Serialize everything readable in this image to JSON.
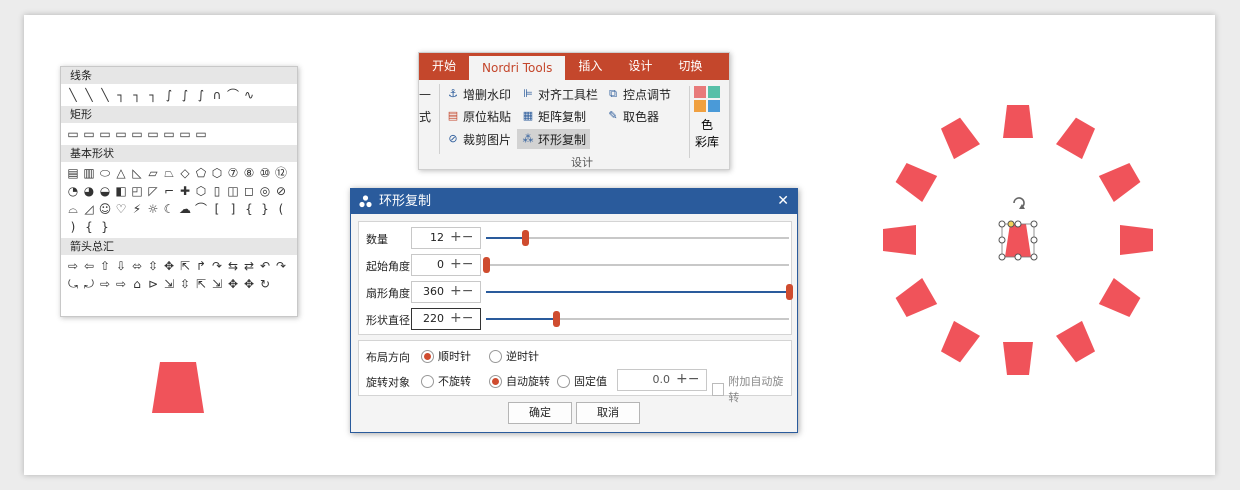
{
  "gallery": {
    "sections": [
      {
        "title": "线条",
        "icons": [
          "╲",
          "╲",
          "╲",
          "┐",
          "┐",
          "┐",
          "∫",
          "∫",
          "∫",
          "∩",
          "⌒",
          "∿"
        ]
      },
      {
        "title": "矩形",
        "icons": [
          "▭",
          "▭",
          "▭",
          "▭",
          "▭",
          "▭",
          "▭",
          "▭",
          "▭"
        ]
      },
      {
        "title": "基本形状",
        "icons": [
          "▤",
          "▥",
          "⬭",
          "△",
          "◺",
          "▱",
          "⏢",
          "◇",
          "⬠",
          "⬡",
          "⑦",
          "⑧",
          "⑩",
          "⑫",
          "◔",
          "◕",
          "◒",
          "◧",
          "◰",
          "◸",
          "⌐",
          "✚",
          "⬡",
          "▯",
          "◫",
          "◻",
          "◎",
          "⊘",
          "⌓",
          "◿",
          "☺",
          "♡",
          "⚡",
          "☼",
          "☾",
          "☁",
          "⌒",
          "[",
          "]",
          "{",
          "}",
          "(",
          ")",
          "{",
          "}"
        ]
      },
      {
        "title": "箭头总汇",
        "icons": [
          "⇨",
          "⇦",
          "⇧",
          "⇩",
          "⬄",
          "⇳",
          "✥",
          "⇱",
          "↱",
          "↷",
          "⇆",
          "⇄",
          "↶",
          "↷",
          "⤿",
          "⤾",
          "⇨",
          "⇨",
          "⌂",
          "⊳",
          "⇲",
          "⇳",
          "⇱",
          "⇲",
          "✥",
          "✥",
          "↻"
        ]
      }
    ]
  },
  "ribbon": {
    "tabs": [
      {
        "label": "开始",
        "active": false
      },
      {
        "label": "Nordri Tools",
        "active": true
      },
      {
        "label": "插入",
        "active": false
      },
      {
        "label": "设计",
        "active": false
      },
      {
        "label": "切换",
        "active": false
      }
    ],
    "partial_label": "式",
    "items": [
      {
        "label": "增删水印",
        "icon": "stamp-icon"
      },
      {
        "label": "对齐工具栏",
        "icon": "align-icon"
      },
      {
        "label": "控点调节",
        "icon": "handle-icon"
      },
      {
        "label": "原位粘贴",
        "icon": "paste-icon"
      },
      {
        "label": "矩阵复制",
        "icon": "matrix-icon"
      },
      {
        "label": "取色器",
        "icon": "eyedropper-icon"
      },
      {
        "label": "裁剪图片",
        "icon": "crop-icon"
      },
      {
        "label": "环形复制",
        "icon": "ring-copy-icon"
      }
    ],
    "group_label": "设计",
    "color_library": {
      "line1": "色",
      "line2": "彩库",
      "swatches": [
        "#e87a7a",
        "#57c0a8",
        "#f0a040",
        "#4a9ad8"
      ]
    }
  },
  "dialog": {
    "title": "环形复制",
    "rows": [
      {
        "label": "数量",
        "value": "12",
        "fraction": 0.13
      },
      {
        "label": "起始角度",
        "value": "0",
        "fraction": 0.0
      },
      {
        "label": "扇形角度",
        "value": "360",
        "fraction": 1.0
      },
      {
        "label": "形状直径",
        "value": "220",
        "fraction": 0.23
      }
    ],
    "layout_direction": {
      "label": "布局方向",
      "options": [
        "顺时针",
        "逆时针"
      ],
      "selected": "顺时针"
    },
    "rotate_target": {
      "label": "旋转对象",
      "options": [
        "不旋转",
        "自动旋转",
        "固定值"
      ],
      "selected": "自动旋转"
    },
    "fixed_value": "0.0",
    "extra_checkbox": "附加自动旋转",
    "ok_label": "确定",
    "cancel_label": "取消"
  },
  "shape_color": "#f0535a",
  "ring_count": 12
}
